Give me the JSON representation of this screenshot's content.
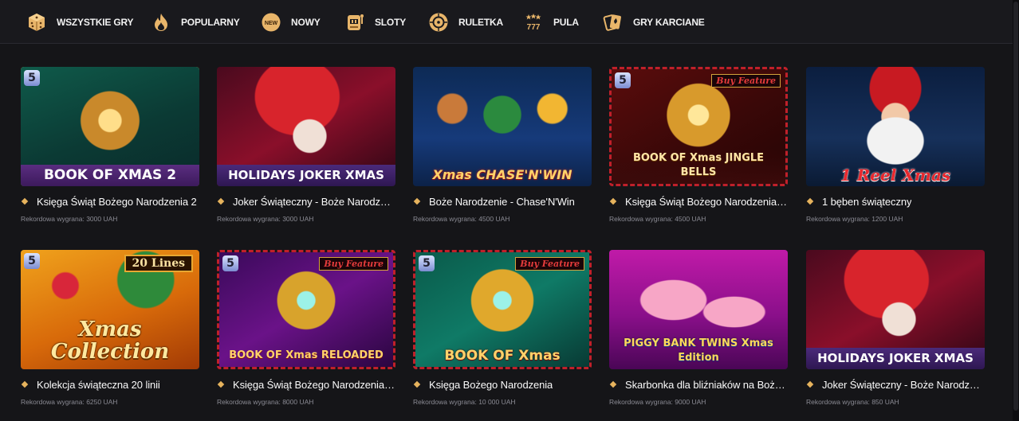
{
  "nav": [
    {
      "label": "WSZYSTKIE GRY",
      "icon": "dice-icon"
    },
    {
      "label": "POPULARNY",
      "icon": "flame-icon"
    },
    {
      "label": "NOWY",
      "icon": "new-badge-icon",
      "icon_text": "NEW"
    },
    {
      "label": "SLOTY",
      "icon": "slot-machine-icon"
    },
    {
      "label": "RULETKA",
      "icon": "roulette-icon"
    },
    {
      "label": "PULA",
      "icon": "jackpot-777-icon",
      "icon_text": "777"
    },
    {
      "label": "GRY KARCIANE",
      "icon": "playing-cards-icon"
    }
  ],
  "colors": {
    "accent": "#f4c46a",
    "background": "#151518",
    "nav_bg": "#19191d",
    "muted": "#8b8b94",
    "diamond": "#e6b35d"
  },
  "games": [
    {
      "name": "Księga Świąt Bożego Narodzenia 2",
      "win": "Rekordowa wygrana: 3000 UAH",
      "art_title": "BOOK OF XMAS 2",
      "badge": "5",
      "art": "book-green"
    },
    {
      "name": "Joker Świąteczny - Boże Narodzenie",
      "win": "Rekordowa wygrana: 3000 UAH",
      "art_title": "HOLIDAYS JOKER XMAS",
      "art": "joker"
    },
    {
      "name": "Boże Narodzenie - Chase'N'Win",
      "win": "Rekordowa wygrana: 4500 UAH",
      "art_title": "Xmas CHASE'N'WIN",
      "art": "chase"
    },
    {
      "name": "Księga Świąt Bożego Narodzenia Jingle Bells",
      "win": "Rekordowa wygrana: 4500 UAH",
      "art_title": "BOOK OF Xmas JINGLE BELLS",
      "badge": "5",
      "tag": "Buy Feature",
      "art": "book-red"
    },
    {
      "name": "1 bęben świąteczny",
      "win": "Rekordowa wygrana: 1200 UAH",
      "art_title": "1 Reel Xmas",
      "art": "santa"
    },
    {
      "name": "Kolekcja świąteczna 20 linii",
      "win": "Rekordowa wygrana: 6250 UAH",
      "art_title": "Xmas Collection",
      "badge": "5",
      "tag": "20 Lines",
      "art": "collection"
    },
    {
      "name": "Księga Świąt Bożego Narodzenia Reloaded",
      "win": "Rekordowa wygrana: 8000 UAH",
      "art_title": "BOOK OF Xmas RELOADED",
      "badge": "5",
      "tag": "Buy Feature",
      "art": "book-purple"
    },
    {
      "name": "Księga Bożego Narodzenia",
      "win": "Rekordowa wygrana: 10 000 UAH",
      "art_title": "BOOK OF Xmas",
      "badge": "5",
      "tag": "Buy Feature",
      "art": "book-teal"
    },
    {
      "name": "Skarbonka dla bliźniaków na Boże Narodzenie",
      "win": "Rekordowa wygrana: 9000 UAH",
      "art_title": "PIGGY BANK TWINS Xmas Edition",
      "art": "piggy"
    },
    {
      "name": "Joker Świąteczny - Boże Narodzenie",
      "win": "Rekordowa wygrana: 850 UAH",
      "art_title": "HOLIDAYS JOKER XMAS",
      "art": "joker"
    }
  ]
}
